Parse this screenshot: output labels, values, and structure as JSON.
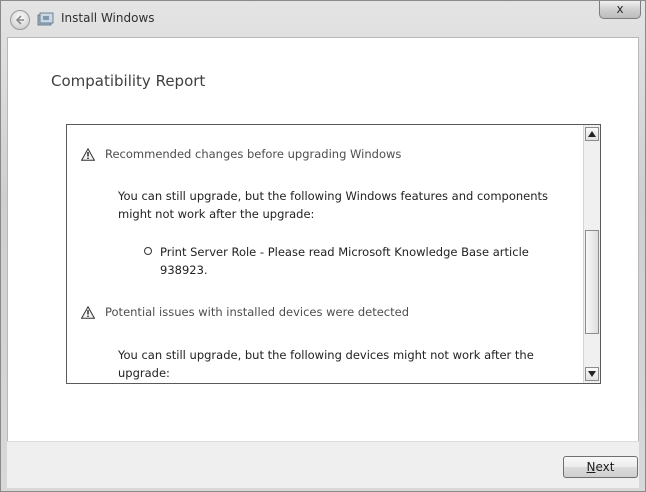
{
  "window": {
    "title": "Install Windows",
    "close_glyph": "x"
  },
  "page": {
    "title": "Compatibility Report"
  },
  "report": {
    "sections": [
      {
        "heading": "Recommended changes before upgrading Windows",
        "paragraph_line1": "You can still upgrade, but the following Windows features and components",
        "paragraph_line2": "might not work after the upgrade:",
        "bullet_line1": "Print Server Role - Please read Microsoft Knowledge Base article",
        "bullet_line2": "938923."
      },
      {
        "heading": "Potential issues with installed devices were detected",
        "paragraph_line1": "You can still upgrade, but the following devices might not work after the",
        "paragraph_line2": "upgrade:"
      }
    ]
  },
  "footer": {
    "next_label_first": "N",
    "next_label_rest": "ext"
  },
  "icons": {
    "back": "back-arrow-icon",
    "app": "windows-setup-icon",
    "warning": "warning-icon",
    "scroll_up": "scroll-up-arrow-icon",
    "scroll_down": "scroll-down-arrow-icon"
  }
}
